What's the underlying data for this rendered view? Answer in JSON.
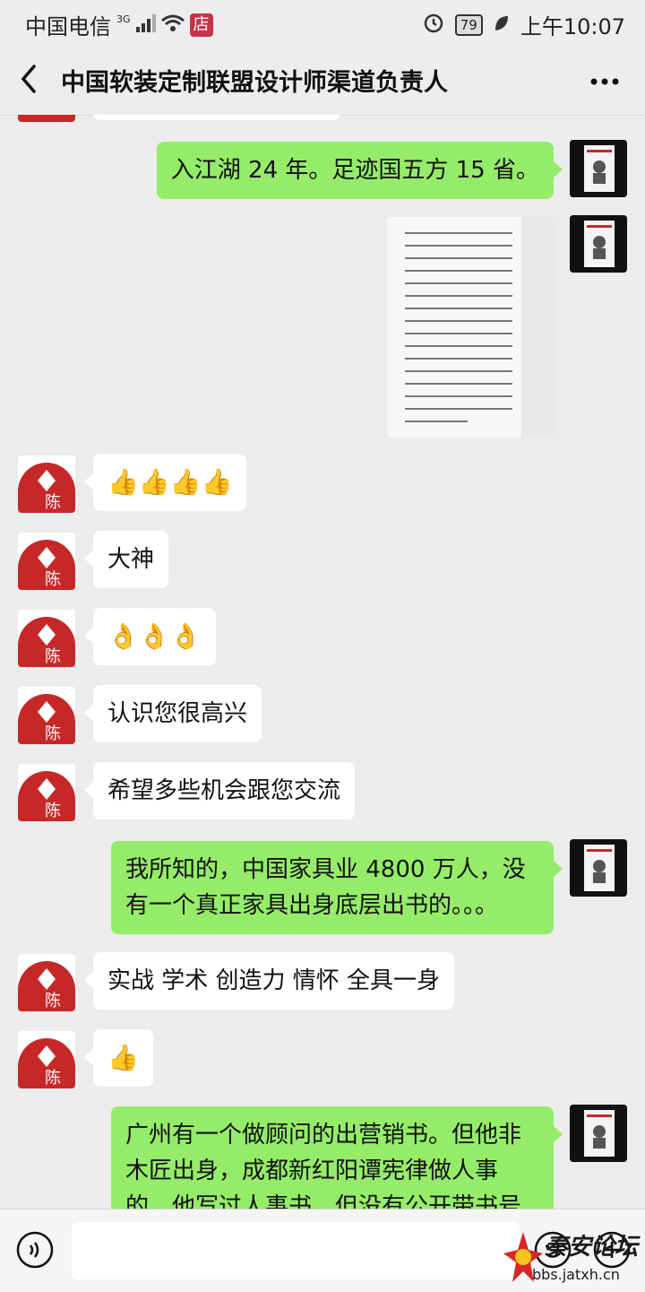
{
  "status_bar": {
    "carrier": "中国电信",
    "network": "3G",
    "store_badge": "店",
    "battery": "79",
    "time": "上午10:07"
  },
  "header": {
    "title": "中国软装定制联盟设计师渠道负责人"
  },
  "messages": [
    {
      "side": "right",
      "type": "text",
      "text": "入江湖 24 年。足迹国五方 15 省。"
    },
    {
      "side": "right",
      "type": "image"
    },
    {
      "side": "left",
      "type": "emoji",
      "emoji": "👍👍👍👍"
    },
    {
      "side": "left",
      "type": "text",
      "text": "大神"
    },
    {
      "side": "left",
      "type": "emoji",
      "emoji": "👌👌👌"
    },
    {
      "side": "left",
      "type": "text",
      "text": "认识您很高兴"
    },
    {
      "side": "left",
      "type": "text",
      "text": "希望多些机会跟您交流"
    },
    {
      "side": "right",
      "type": "text",
      "text": "我所知的，中国家具业 4800 万人，没有一个真正家具出身底层出书的。。。"
    },
    {
      "side": "left",
      "type": "text",
      "text": "实战 学术 创造力 情怀 全具一身"
    },
    {
      "side": "left",
      "type": "emoji",
      "emoji": "👍"
    },
    {
      "side": "right",
      "type": "text",
      "text": "广州有一个做顾问的出营销书。但他非木匠出身，成都新红阳谭宪律做人事的，他写过人事书，但没有公开带书号"
    }
  ],
  "watermark": {
    "text": "秦安论坛",
    "url": "bbs.jatxh.cn"
  },
  "colors": {
    "bubble_right": "#95ec69",
    "bubble_left": "#ffffff",
    "background": "#ececec",
    "avatar_red": "#c62828"
  }
}
